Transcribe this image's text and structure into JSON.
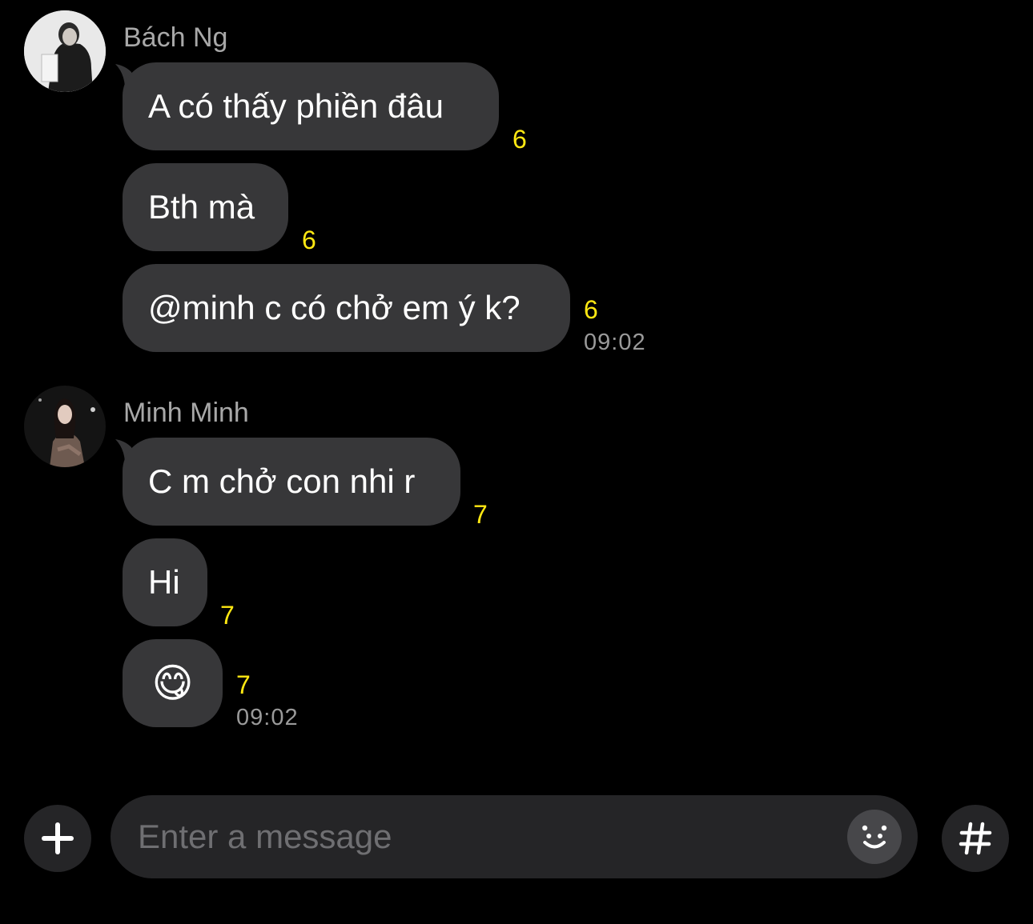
{
  "groups": [
    {
      "sender": "Bách Ng",
      "avatar_icon": "profile-photo-bach",
      "messages": [
        {
          "text": "A có thấy phiền đâu",
          "unread": "6"
        },
        {
          "text": "Bth mà",
          "unread": "6"
        },
        {
          "text": "@minh c có chở em ý k?",
          "unread": "6",
          "time": "09:02"
        }
      ]
    },
    {
      "sender": "Minh Minh",
      "avatar_icon": "profile-photo-minh",
      "messages": [
        {
          "text": "C m chở con nhi r",
          "unread": "7"
        },
        {
          "text": "Hi",
          "unread": "7"
        },
        {
          "text": "😋",
          "unread": "7",
          "time": "09:02"
        }
      ]
    }
  ],
  "composer": {
    "placeholder": "Enter a message",
    "add_icon": "plus-icon",
    "emoji_icon": "smiley-face-icon",
    "hashtag_icon": "hashtag-icon"
  },
  "colors": {
    "background": "#000000",
    "bubble": "#373739",
    "unread_count": "#ffe812",
    "timestamp": "#9a9a9a",
    "input_bar": "#252527"
  }
}
